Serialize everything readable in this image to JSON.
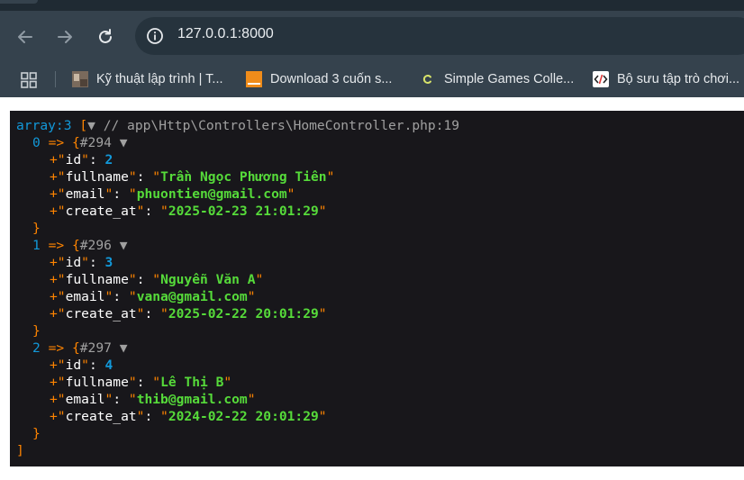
{
  "browser": {
    "url": "127.0.0.1:8000",
    "bookmarks": [
      {
        "label": "Kỹ thuật lập trình | T..."
      },
      {
        "label": "Download 3 cuốn s..."
      },
      {
        "label": "Simple Games Colle..."
      },
      {
        "label": "Bộ sưu tập trò chơi..."
      }
    ]
  },
  "dump": {
    "header_type": "array:3",
    "header_open": "[",
    "toggle": "▼",
    "source": "// app\\Http\\Controllers\\HomeController.php:19",
    "arrow": "=>",
    "obj_open": "{",
    "obj_close": "}",
    "arr_close": "]",
    "plus": "+",
    "items": [
      {
        "index": "0",
        "ref": "#294",
        "fields": [
          {
            "key": "id",
            "value": "2",
            "kind": "int"
          },
          {
            "key": "fullname",
            "value": "Trần Ngọc Phương Tiên",
            "kind": "str"
          },
          {
            "key": "email",
            "value": "phuontien@gmail.com",
            "kind": "str"
          },
          {
            "key": "create_at",
            "value": "2025-02-23 21:01:29",
            "kind": "str"
          }
        ]
      },
      {
        "index": "1",
        "ref": "#296",
        "fields": [
          {
            "key": "id",
            "value": "3",
            "kind": "int"
          },
          {
            "key": "fullname",
            "value": "Nguyễn Văn A",
            "kind": "str"
          },
          {
            "key": "email",
            "value": "vana@gmail.com",
            "kind": "str"
          },
          {
            "key": "create_at",
            "value": "2025-02-22 20:01:29",
            "kind": "str"
          }
        ]
      },
      {
        "index": "2",
        "ref": "#297",
        "fields": [
          {
            "key": "id",
            "value": "4",
            "kind": "int"
          },
          {
            "key": "fullname",
            "value": "Lê Thị B",
            "kind": "str"
          },
          {
            "key": "email",
            "value": "thib@gmail.com",
            "kind": "str"
          },
          {
            "key": "create_at",
            "value": "2024-02-22 20:01:29",
            "kind": "str"
          }
        ]
      }
    ]
  }
}
